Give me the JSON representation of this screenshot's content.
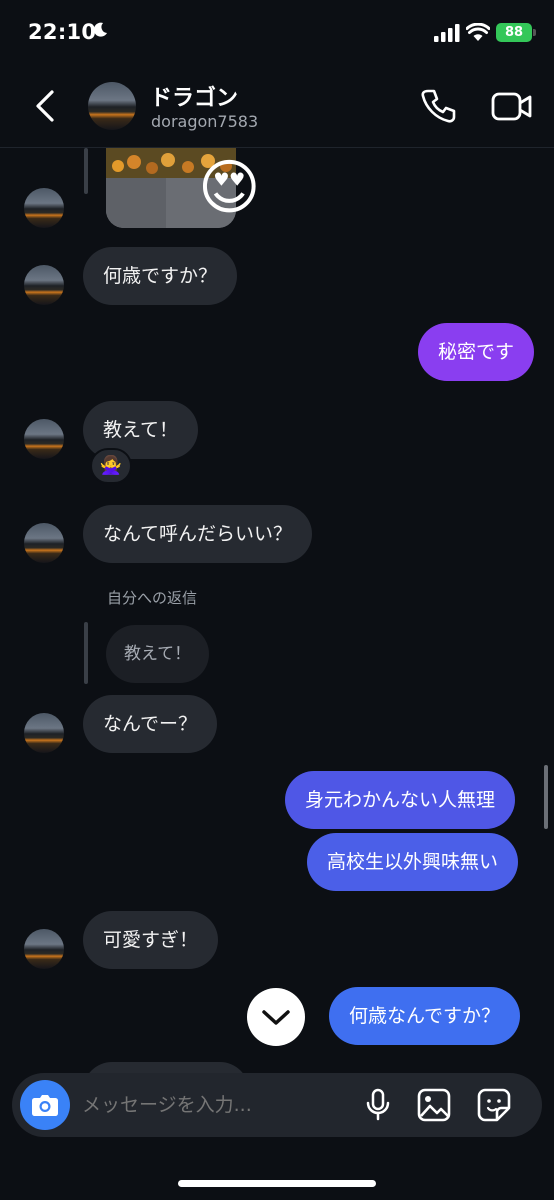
{
  "status_bar": {
    "time": "22:10",
    "battery": "88"
  },
  "header": {
    "name": "ドラゴン",
    "username": "doragon7583",
    "icons": [
      "back-icon",
      "phone-icon",
      "video-camera-icon"
    ]
  },
  "messages": [
    {
      "side": "in",
      "text": "何歳ですか？"
    },
    {
      "side": "out",
      "text": "秘密です",
      "color": "#8a3ef0"
    },
    {
      "side": "in",
      "text": "教えて！",
      "reaction": "🙅‍♀️"
    },
    {
      "side": "in",
      "text": "なんて呼んだらいい？"
    },
    {
      "side": "in",
      "text": "なんでー？",
      "reply_label": "自分への返信",
      "reply_quote": "教えて！"
    },
    {
      "side": "out",
      "text": "身元わかんない人無理",
      "color": "#4f57e6"
    },
    {
      "side": "out",
      "text": "高校生以外興味無い",
      "color": "#4b5fe8"
    },
    {
      "side": "in",
      "text": "可愛すぎ！"
    },
    {
      "side": "out",
      "text": "何歳なんですか？",
      "color": "#3f6ff0"
    }
  ],
  "reaction_emoji": "😍",
  "composer": {
    "placeholder": "メッセージを入力..."
  },
  "colors": {
    "background": "#0c0f14",
    "incoming_bubble": "#262a31",
    "camera_button": "#3a82f7"
  }
}
